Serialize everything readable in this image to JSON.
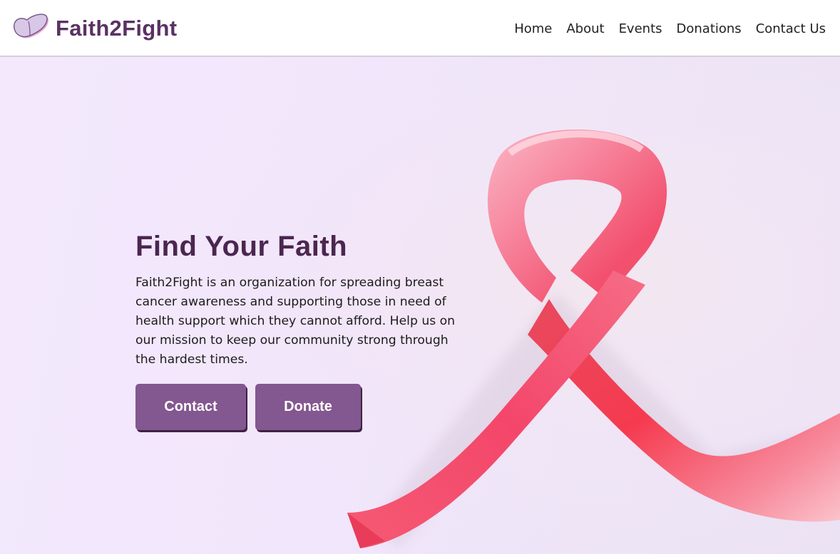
{
  "brand": {
    "name": "Faith2Fight",
    "logo_icon": "butterfly-icon"
  },
  "nav": {
    "items": [
      {
        "label": "Home"
      },
      {
        "label": "About"
      },
      {
        "label": "Events"
      },
      {
        "label": "Donations"
      },
      {
        "label": "Contact Us"
      }
    ]
  },
  "hero": {
    "title": "Find Your Faith",
    "description": "Faith2Fight is an organization for spreading breast cancer awareness and supporting those in need of health support which they cannot afford. Help us on our mission to keep our community strong through the hardest times.",
    "buttons": {
      "contact_label": "Contact",
      "donate_label": "Donate"
    },
    "background_icon": "pink-ribbon-icon"
  },
  "colors": {
    "brand_purple": "#5a3262",
    "button_purple": "#83578f",
    "hero_background": "#f4e9fb",
    "ribbon_pink": "#f2506e"
  }
}
